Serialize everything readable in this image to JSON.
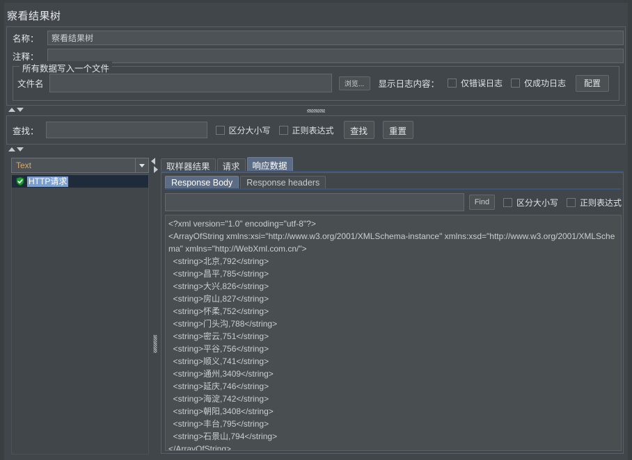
{
  "window": {
    "title": "察看结果树"
  },
  "form": {
    "name_label": "名称：",
    "name_value": "察看结果树",
    "comment_label": "注释：",
    "comment_value": "",
    "groupbox_title": "所有数据写入一个文件",
    "filename_label": "文件名",
    "filename_value": "",
    "browse_button": "浏览...",
    "show_log_label": "显示日志内容：",
    "error_log_only_label": "仅错误日志",
    "error_log_only_checked": false,
    "success_log_only_label": "仅成功日志",
    "success_log_only_checked": false,
    "config_button": "配置"
  },
  "search": {
    "label": "查找：",
    "value": "",
    "match_case_label": "区分大小写",
    "match_case_checked": false,
    "regex_label": "正则表达式",
    "regex_checked": false,
    "find_button": "查找",
    "reset_button": "重置"
  },
  "left_panel": {
    "renderer_selected": "Text",
    "tree_items": [
      {
        "label": "HTTP请求",
        "icon": "shield-check-icon",
        "selected": true
      }
    ]
  },
  "right_panel": {
    "tabs": [
      {
        "label": "取样器结果",
        "active": false
      },
      {
        "label": "请求",
        "active": false
      },
      {
        "label": "响应数据",
        "active": true
      }
    ],
    "subtabs": [
      {
        "label": "Response Body",
        "active": true
      },
      {
        "label": "Response headers",
        "active": false
      }
    ],
    "find": {
      "value": "",
      "button": "Find",
      "match_case_label": "区分大小写",
      "match_case_checked": false,
      "regex_label": "正则表达式",
      "regex_checked": false
    },
    "response_body_lines": [
      "<?xml version=\"1.0\" encoding=\"utf-8\"?>",
      "<ArrayOfString xmlns:xsi=\"http://www.w3.org/2001/XMLSchema-instance\" xmlns:xsd=\"http://www.w3.org/2001/XMLSchema\" xmlns=\"http://WebXml.com.cn/\">",
      "  <string>北京,792</string>",
      "  <string>昌平,785</string>",
      "  <string>大兴,826</string>",
      "  <string>房山,827</string>",
      "  <string>怀柔,752</string>",
      "  <string>门头沟,788</string>",
      "  <string>密云,751</string>",
      "  <string>平谷,756</string>",
      "  <string>顺义,741</string>",
      "  <string>通州,3409</string>",
      "  <string>延庆,746</string>",
      "  <string>海淀,742</string>",
      "  <string>朝阳,3408</string>",
      "  <string>丰台,795</string>",
      "  <string>石景山,794</string>",
      "</ArrayOfString>"
    ]
  },
  "colors": {
    "window_bg": "#41464a",
    "field_bg": "#4d5256",
    "accent_tab": "#5c6c85",
    "accent_underline": "#3d5378",
    "tree_selected_row": "#1f2b3b",
    "tree_selected_label": "#7c9fd2",
    "combo_text": "#d7a86e",
    "text_area_bg": "#494e50"
  }
}
